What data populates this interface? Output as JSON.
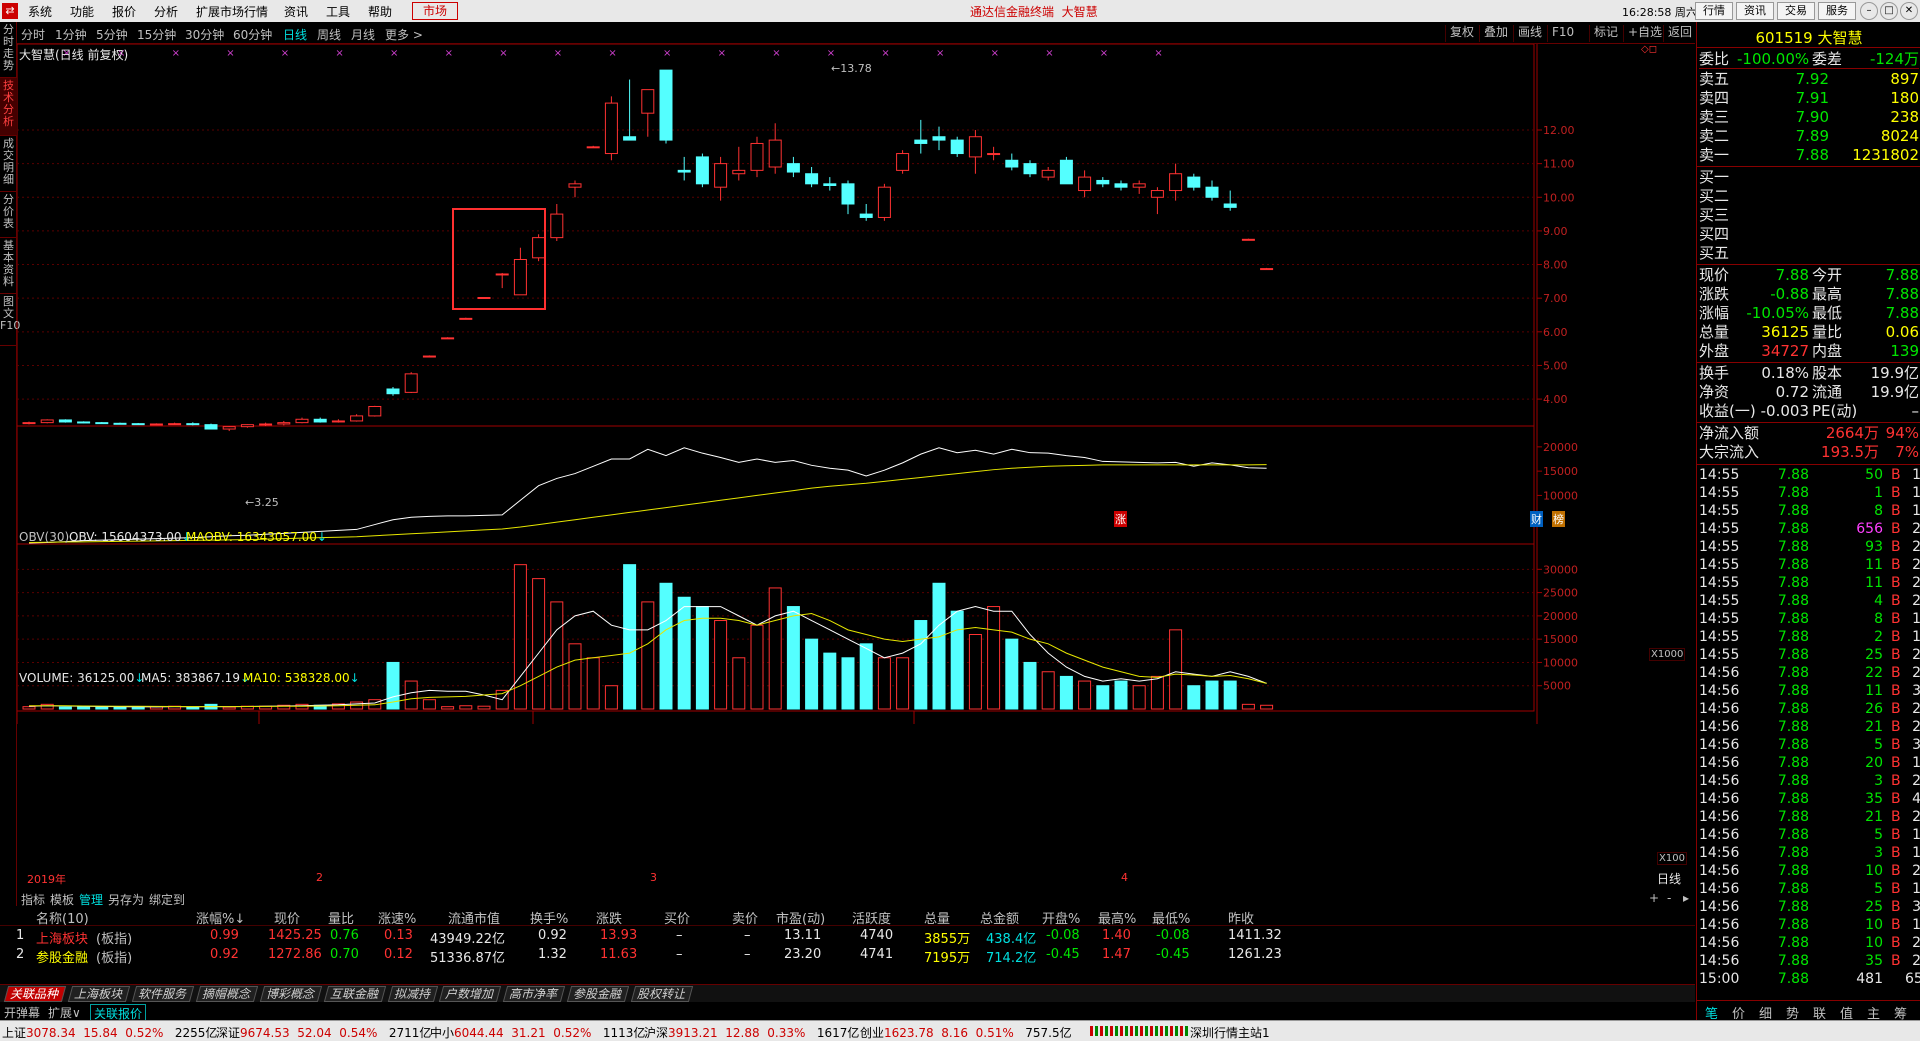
{
  "menu": {
    "logo": "⇄",
    "items": [
      "系统",
      "功能",
      "报价",
      "分析",
      "扩展市场行情",
      "资讯",
      "工具",
      "帮助"
    ],
    "market_label": "市场",
    "center_title": "通达信金融终端",
    "center_stock": "大智慧",
    "clock": "16:28:58 周六",
    "top_buttons": [
      "行情",
      "资讯",
      "交易",
      "服务"
    ]
  },
  "period_bar": {
    "items": [
      "分时",
      "1分钟",
      "5分钟",
      "15分钟",
      "30分钟",
      "60分钟",
      "日线",
      "周线",
      "月线",
      "更多 >"
    ],
    "active": "日线",
    "right_buttons": [
      "复权",
      "叠加",
      "画线",
      "F10",
      "标记",
      "+自选",
      "返回"
    ]
  },
  "left_tabs": [
    "分时走势",
    "技术分析",
    "成交明细",
    "分价表",
    "基本资料",
    "图文F10"
  ],
  "left_tab_active": "技术分析",
  "chart": {
    "title": "大智慧(日线 前复权)",
    "price_high_label": "13.78",
    "price_low_label": "3.25",
    "badges": [
      "涨",
      "财",
      "榜"
    ],
    "obv_label": "OBV(30)",
    "obv_value": "OBV: 15604373.00",
    "maobv_value": "MAOBV: 16343057.00",
    "obv_unit": "X1000",
    "vol_label": "VOLUME: 36125.00",
    "ma5_label": "MA5: 383867.19",
    "ma10_label": "MA10: 538328.00",
    "vol_unit": "X100",
    "time_labels": [
      "2019年",
      "2",
      "3",
      "4"
    ],
    "period_label": "日线",
    "price_ticks": [
      "12.00",
      "11.00",
      "10.00",
      "9.00",
      "8.00",
      "7.00",
      "6.00",
      "5.00",
      "4.00"
    ],
    "obv_ticks": [
      "20000",
      "15000",
      "10000"
    ],
    "vol_ticks": [
      "30000",
      "25000",
      "20000",
      "15000",
      "10000",
      "5000"
    ],
    "colors": {
      "up": "#ff3232",
      "down": "#54ffff",
      "ma1": "#ffffff",
      "ma2": "#e6e600"
    }
  },
  "chart_data": {
    "type": "candlestick",
    "price_ylim": [
      3.2,
      14.2
    ],
    "candles": [
      [
        3.3,
        3.33,
        3.25,
        3.3
      ],
      [
        3.3,
        3.4,
        3.28,
        3.38
      ],
      [
        3.38,
        3.4,
        3.3,
        3.32
      ],
      [
        3.32,
        3.34,
        3.28,
        3.3
      ],
      [
        3.3,
        3.32,
        3.26,
        3.28
      ],
      [
        3.28,
        3.3,
        3.25,
        3.27
      ],
      [
        3.27,
        3.29,
        3.24,
        3.25
      ],
      [
        3.25,
        3.28,
        3.22,
        3.26
      ],
      [
        3.26,
        3.3,
        3.24,
        3.27
      ],
      [
        3.27,
        3.31,
        3.22,
        3.24
      ],
      [
        3.24,
        3.27,
        3.1,
        3.11
      ],
      [
        3.11,
        3.2,
        3.05,
        3.18
      ],
      [
        3.18,
        3.25,
        3.15,
        3.24
      ],
      [
        3.24,
        3.3,
        3.2,
        3.26
      ],
      [
        3.26,
        3.35,
        3.22,
        3.3
      ],
      [
        3.3,
        3.45,
        3.28,
        3.4
      ],
      [
        3.4,
        3.45,
        3.3,
        3.32
      ],
      [
        3.32,
        3.4,
        3.3,
        3.35
      ],
      [
        3.35,
        3.55,
        3.33,
        3.5
      ],
      [
        3.5,
        3.8,
        3.48,
        3.78
      ],
      [
        4.3,
        4.36,
        4.1,
        4.16
      ],
      [
        4.2,
        4.8,
        4.18,
        4.75
      ],
      [
        5.25,
        5.3,
        5.25,
        5.28
      ],
      [
        5.8,
        5.84,
        5.8,
        5.82
      ],
      [
        6.4,
        6.42,
        6.4,
        6.4
      ],
      [
        7.0,
        7.03,
        7.0,
        7.02
      ],
      [
        7.7,
        7.75,
        7.3,
        7.72
      ],
      [
        7.1,
        8.5,
        7.1,
        8.15
      ],
      [
        8.2,
        8.9,
        8.1,
        8.8
      ],
      [
        8.8,
        9.8,
        8.7,
        9.5
      ],
      [
        10.3,
        10.5,
        10.0,
        10.4
      ],
      [
        11.5,
        11.53,
        11.5,
        11.5
      ],
      [
        11.3,
        13.0,
        11.1,
        12.8
      ],
      [
        11.8,
        13.5,
        11.7,
        11.7
      ],
      [
        12.5,
        13.2,
        11.8,
        13.2
      ],
      [
        13.78,
        13.78,
        11.6,
        11.7
      ],
      [
        10.8,
        11.2,
        10.5,
        10.75
      ],
      [
        11.2,
        11.3,
        10.3,
        10.4
      ],
      [
        10.3,
        11.2,
        9.9,
        11.0
      ],
      [
        10.7,
        11.5,
        10.5,
        10.8
      ],
      [
        10.8,
        11.8,
        10.6,
        11.6
      ],
      [
        10.9,
        12.2,
        10.7,
        11.7
      ],
      [
        11.0,
        11.2,
        10.6,
        10.75
      ],
      [
        10.7,
        10.9,
        10.3,
        10.4
      ],
      [
        10.4,
        10.6,
        10.2,
        10.35
      ],
      [
        10.4,
        10.5,
        9.5,
        9.8
      ],
      [
        9.5,
        9.8,
        9.3,
        9.4
      ],
      [
        9.4,
        10.4,
        9.3,
        10.3
      ],
      [
        10.8,
        11.4,
        10.7,
        11.3
      ],
      [
        11.7,
        12.3,
        11.3,
        11.6
      ],
      [
        11.8,
        12.1,
        11.4,
        11.7
      ],
      [
        11.7,
        11.8,
        11.2,
        11.3
      ],
      [
        11.2,
        12.0,
        10.7,
        11.8
      ],
      [
        11.3,
        11.5,
        11.1,
        11.3
      ],
      [
        11.1,
        11.3,
        10.8,
        10.9
      ],
      [
        11.0,
        11.1,
        10.6,
        10.7
      ],
      [
        10.6,
        10.9,
        10.5,
        10.8
      ],
      [
        11.1,
        11.2,
        10.4,
        10.4
      ],
      [
        10.2,
        10.8,
        10.0,
        10.6
      ],
      [
        10.5,
        10.6,
        10.3,
        10.4
      ],
      [
        10.4,
        10.5,
        10.2,
        10.3
      ],
      [
        10.3,
        10.5,
        10.1,
        10.4
      ],
      [
        10.0,
        10.3,
        9.5,
        10.2
      ],
      [
        10.2,
        11.0,
        9.9,
        10.7
      ],
      [
        10.6,
        10.7,
        10.2,
        10.3
      ],
      [
        10.3,
        10.5,
        9.9,
        10.0
      ],
      [
        9.8,
        10.2,
        9.6,
        9.7
      ],
      [
        8.75,
        8.77,
        8.73,
        8.75
      ],
      [
        7.88,
        7.9,
        7.88,
        7.88
      ]
    ],
    "obv_ylim": [
      0,
      21000
    ],
    "obv": [
      200,
      300,
      500,
      700,
      800,
      900,
      1000,
      1100,
      1200,
      1300,
      1500,
      1700,
      1800,
      2000,
      2200,
      2400,
      2600,
      2800,
      3000,
      4000,
      5000,
      5500,
      5700,
      5800,
      5800,
      5900,
      6000,
      9000,
      12000,
      13500,
      14500,
      16000,
      17500,
      17500,
      19500,
      18200,
      19800,
      18700,
      17800,
      16800,
      17500,
      16800,
      17200,
      16200,
      15600,
      15200,
      14000,
      15200,
      16700,
      18500,
      19800,
      18800,
      19300,
      18500,
      19500,
      18800,
      18700,
      18200,
      17800,
      17000,
      16900,
      16800,
      16700,
      16800,
      16000,
      16700,
      16300,
      15700,
      15600
    ],
    "maobv": [
      300,
      350,
      400,
      450,
      500,
      550,
      600,
      650,
      700,
      750,
      800,
      850,
      900,
      1000,
      1100,
      1200,
      1300,
      1400,
      1500,
      1700,
      1900,
      2100,
      2300,
      2500,
      2700,
      2900,
      3100,
      3500,
      4000,
      4500,
      5000,
      5500,
      6000,
      6500,
      7000,
      7500,
      8000,
      8500,
      9000,
      9500,
      10000,
      10500,
      11000,
      11500,
      11900,
      12200,
      12500,
      12900,
      13300,
      13700,
      14100,
      14500,
      14900,
      15300,
      15600,
      15800,
      16000,
      16100,
      16200,
      16300,
      16300,
      16300,
      16300,
      16300,
      16300,
      16300,
      16300,
      16300,
      16343
    ],
    "volume_ylim": [
      0,
      32000
    ],
    "volume": [
      500,
      1000,
      400,
      500,
      400,
      500,
      300,
      500,
      600,
      400,
      1000,
      400,
      600,
      600,
      800,
      1000,
      800,
      1100,
      1500,
      2000,
      10000,
      6000,
      2000,
      500,
      700,
      600,
      4000,
      31000,
      28000,
      23000,
      14000,
      11000,
      5000,
      31000,
      23000,
      27000,
      24000,
      22000,
      19000,
      11000,
      18000,
      26000,
      22000,
      15000,
      12000,
      11000,
      14000,
      11000,
      11000,
      19000,
      27000,
      21000,
      16000,
      22000,
      15000,
      10000,
      8000,
      7000,
      6000,
      5000,
      6000,
      5000,
      7000,
      17000,
      5000,
      6000,
      6000,
      1000,
      800
    ],
    "ma5": [
      600,
      700,
      650,
      600,
      550,
      500,
      480,
      450,
      500,
      470,
      500,
      520,
      550,
      600,
      650,
      700,
      800,
      900,
      1100,
      1300,
      2600,
      3500,
      4000,
      3800,
      3800,
      3000,
      2000,
      7000,
      12000,
      17000,
      20000,
      21000,
      18000,
      17000,
      17000,
      19000,
      22000,
      22000,
      22000,
      20000,
      18000,
      20000,
      21000,
      19000,
      17000,
      15000,
      13000,
      11000,
      12000,
      14000,
      18000,
      21000,
      22000,
      21000,
      21000,
      16000,
      12000,
      9000,
      7000,
      6000,
      6500,
      6000,
      6500,
      8000,
      7500,
      7000,
      8000,
      7000,
      5500
    ],
    "ma10": [
      700,
      700,
      700,
      650,
      620,
      600,
      580,
      560,
      540,
      520,
      520,
      520,
      540,
      560,
      580,
      600,
      650,
      700,
      800,
      900,
      1500,
      2200,
      2500,
      2600,
      2700,
      3000,
      3300,
      5000,
      7000,
      9000,
      10500,
      11000,
      11500,
      12000,
      14000,
      17000,
      19000,
      19500,
      19500,
      19000,
      18000,
      19000,
      20000,
      20500,
      19000,
      17000,
      16000,
      15000,
      14500,
      15000,
      15500,
      17000,
      17500,
      17000,
      16500,
      15000,
      14000,
      12000,
      10500,
      9000,
      8000,
      7000,
      6800,
      7500,
      7300,
      7000,
      7200,
      6500,
      5500
    ]
  },
  "bottom_tabs": [
    "指标",
    "模板",
    "管理",
    "另存为",
    "绑定到"
  ],
  "bottom_tab_active": "管理",
  "table": {
    "headers": [
      "名称(10)",
      "涨幅%↓",
      "现价",
      "量比",
      "涨速%",
      "流通市值",
      "换手%",
      "涨跌",
      "买价",
      "卖价",
      "市盈(动)",
      "活跃度",
      "总量",
      "总金额",
      "开盘%",
      "最高%",
      "最低%",
      "昨收"
    ],
    "rows": [
      {
        "idx": "1",
        "name": "上海板块",
        "tag": "(板指)",
        "chg": "0.99",
        "price": "1425.25",
        "ratio": "0.76",
        "speed": "0.13",
        "mktcap": "43949.22亿",
        "turnover": "0.92",
        "diff": "13.93",
        "bid": "–",
        "ask": "–",
        "pe": "13.11",
        "active": "4740",
        "vol": "3855万",
        "amount": "438.4亿",
        "open": "-0.08",
        "high": "1.40",
        "low": "-0.08",
        "prev": "1411.32"
      },
      {
        "idx": "2",
        "name": "参股金融",
        "tag": "(板指)",
        "chg": "0.92",
        "price": "1272.86",
        "ratio": "0.70",
        "speed": "0.12",
        "mktcap": "51336.87亿",
        "turnover": "1.32",
        "diff": "11.63",
        "bid": "–",
        "ask": "–",
        "pe": "23.20",
        "active": "4741",
        "vol": "7195万",
        "amount": "714.2亿",
        "open": "-0.45",
        "high": "1.47",
        "low": "-0.45",
        "prev": "1261.23"
      }
    ]
  },
  "sheets": [
    "关联品种",
    "上海板块",
    "软件服务",
    "摘帽概念",
    "博彩概念",
    "互联金融",
    "拟减持",
    "户数增加",
    "高市净率",
    "参股金融",
    "股权转让"
  ],
  "sheets_active": "关联品种",
  "sheets2": [
    "开弹幕",
    "扩展∨",
    "关联报价"
  ],
  "sheets2_active": "关联报价",
  "status": {
    "sh_label": "上证",
    "sh_val": "3078.34",
    "sh_chg": "15.84",
    "sh_pct": "0.52%",
    "sh_amt": "2255亿",
    "sz_label": "深证",
    "sz_val": "9674.53",
    "sz_chg": "52.04",
    "sz_pct": "0.54%",
    "sz_amt": "2711亿",
    "zx_label": "中小",
    "zx_val": "6044.44",
    "zx_chg": "31.21",
    "zx_pct": "0.52%",
    "zx_amt": "1113亿",
    "hs_label": "沪深",
    "hs_val": "3913.21",
    "hs_chg": "12.88",
    "hs_pct": "0.33%",
    "hs_amt": "1617亿",
    "cy_label": "创业",
    "cy_val": "1623.78",
    "cy_chg": "8.16",
    "cy_pct": "0.51%",
    "cy_amt": "757.5亿",
    "station": "深圳行情主站1"
  },
  "right": {
    "code": "601519",
    "name": "大智慧",
    "weibi_label": "委比",
    "weibi": "-100.00%",
    "weicha_label": "委差",
    "weicha": "-124万",
    "asks": [
      {
        "label": "卖五",
        "price": "7.92",
        "vol": "897"
      },
      {
        "label": "卖四",
        "price": "7.91",
        "vol": "180"
      },
      {
        "label": "卖三",
        "price": "7.90",
        "vol": "238"
      },
      {
        "label": "卖二",
        "price": "7.89",
        "vol": "8024"
      },
      {
        "label": "卖一",
        "price": "7.88",
        "vol": "1231802"
      }
    ],
    "bids": [
      "买一",
      "买二",
      "买三",
      "买四",
      "买五"
    ],
    "quote": [
      {
        "l1": "现价",
        "v1": "7.88",
        "c1": "green",
        "l2": "今开",
        "v2": "7.88",
        "c2": "green"
      },
      {
        "l1": "涨跌",
        "v1": "-0.88",
        "c1": "green",
        "l2": "最高",
        "v2": "7.88",
        "c2": "green"
      },
      {
        "l1": "涨幅",
        "v1": "-10.05%",
        "c1": "green",
        "l2": "最低",
        "v2": "7.88",
        "c2": "green"
      },
      {
        "l1": "总量",
        "v1": "36125",
        "c1": "yellow",
        "l2": "量比",
        "v2": "0.06",
        "c2": "yellow"
      },
      {
        "l1": "外盘",
        "v1": "34727",
        "c1": "red",
        "l2": "内盘",
        "v2": "139",
        "c2": "green"
      }
    ],
    "quote2": [
      {
        "l1": "换手",
        "v1": "0.18%",
        "c1": "white",
        "l2": "股本",
        "v2": "19.9亿",
        "c2": "white"
      },
      {
        "l1": "净资",
        "v1": "0.72",
        "c1": "white",
        "l2": "流通",
        "v2": "19.9亿",
        "c2": "white"
      },
      {
        "l1": "收益(一)",
        "v1": "-0.003",
        "c1": "white",
        "l2": "PE(动)",
        "v2": "–",
        "c2": "white"
      }
    ],
    "flow": [
      {
        "l": "净流入额",
        "v": "2664万",
        "p": "94%"
      },
      {
        "l": "大宗流入",
        "v": "193.5万",
        "p": "7%"
      }
    ],
    "ticks": [
      {
        "t": "14:55",
        "p": "7.88",
        "v": "50",
        "v_color": "green",
        "s": "B",
        "n": "1"
      },
      {
        "t": "14:55",
        "p": "7.88",
        "v": "1",
        "v_color": "green",
        "s": "B",
        "n": "1"
      },
      {
        "t": "14:55",
        "p": "7.88",
        "v": "8",
        "v_color": "green",
        "s": "B",
        "n": "1"
      },
      {
        "t": "14:55",
        "p": "7.88",
        "v": "656",
        "v_color": "magenta",
        "s": "B",
        "n": "2"
      },
      {
        "t": "14:55",
        "p": "7.88",
        "v": "93",
        "v_color": "green",
        "s": "B",
        "n": "2"
      },
      {
        "t": "14:55",
        "p": "7.88",
        "v": "11",
        "v_color": "green",
        "s": "B",
        "n": "2"
      },
      {
        "t": "14:55",
        "p": "7.88",
        "v": "11",
        "v_color": "green",
        "s": "B",
        "n": "2"
      },
      {
        "t": "14:55",
        "p": "7.88",
        "v": "4",
        "v_color": "green",
        "s": "B",
        "n": "2"
      },
      {
        "t": "14:55",
        "p": "7.88",
        "v": "8",
        "v_color": "green",
        "s": "B",
        "n": "1"
      },
      {
        "t": "14:55",
        "p": "7.88",
        "v": "2",
        "v_color": "green",
        "s": "B",
        "n": "1"
      },
      {
        "t": "14:55",
        "p": "7.88",
        "v": "25",
        "v_color": "green",
        "s": "B",
        "n": "2"
      },
      {
        "t": "14:56",
        "p": "7.88",
        "v": "22",
        "v_color": "green",
        "s": "B",
        "n": "2"
      },
      {
        "t": "14:56",
        "p": "7.88",
        "v": "11",
        "v_color": "green",
        "s": "B",
        "n": "3"
      },
      {
        "t": "14:56",
        "p": "7.88",
        "v": "26",
        "v_color": "green",
        "s": "B",
        "n": "2"
      },
      {
        "t": "14:56",
        "p": "7.88",
        "v": "21",
        "v_color": "green",
        "s": "B",
        "n": "2"
      },
      {
        "t": "14:56",
        "p": "7.88",
        "v": "5",
        "v_color": "green",
        "s": "B",
        "n": "3"
      },
      {
        "t": "14:56",
        "p": "7.88",
        "v": "20",
        "v_color": "green",
        "s": "B",
        "n": "1"
      },
      {
        "t": "14:56",
        "p": "7.88",
        "v": "3",
        "v_color": "green",
        "s": "B",
        "n": "2"
      },
      {
        "t": "14:56",
        "p": "7.88",
        "v": "35",
        "v_color": "green",
        "s": "B",
        "n": "4"
      },
      {
        "t": "14:56",
        "p": "7.88",
        "v": "21",
        "v_color": "green",
        "s": "B",
        "n": "2"
      },
      {
        "t": "14:56",
        "p": "7.88",
        "v": "5",
        "v_color": "green",
        "s": "B",
        "n": "1"
      },
      {
        "t": "14:56",
        "p": "7.88",
        "v": "3",
        "v_color": "green",
        "s": "B",
        "n": "1"
      },
      {
        "t": "14:56",
        "p": "7.88",
        "v": "10",
        "v_color": "green",
        "s": "B",
        "n": "2"
      },
      {
        "t": "14:56",
        "p": "7.88",
        "v": "5",
        "v_color": "green",
        "s": "B",
        "n": "1"
      },
      {
        "t": "14:56",
        "p": "7.88",
        "v": "25",
        "v_color": "green",
        "s": "B",
        "n": "3"
      },
      {
        "t": "14:56",
        "p": "7.88",
        "v": "10",
        "v_color": "green",
        "s": "B",
        "n": "1"
      },
      {
        "t": "14:56",
        "p": "7.88",
        "v": "10",
        "v_color": "green",
        "s": "B",
        "n": "2"
      },
      {
        "t": "14:56",
        "p": "7.88",
        "v": "35",
        "v_color": "green",
        "s": "B",
        "n": "2"
      },
      {
        "t": "15:00",
        "p": "7.88",
        "v": "481",
        "v_color": "white",
        "s": "",
        "n": "65"
      }
    ],
    "bottom_tabs": [
      "笔",
      "价",
      "细",
      "势",
      "联",
      "值",
      "主",
      "筹"
    ],
    "bottom_active": "笔"
  }
}
